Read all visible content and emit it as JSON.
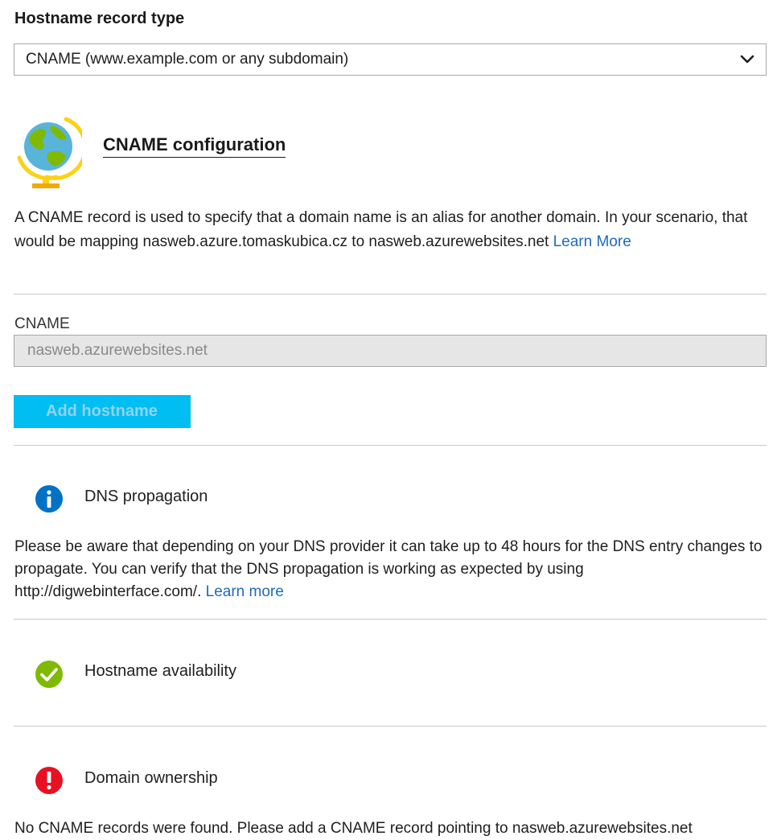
{
  "record_type": {
    "label": "Hostname record type",
    "selected": "CNAME (www.example.com or any subdomain)"
  },
  "cname_config": {
    "title": "CNAME configuration",
    "description": "A CNAME record is used to specify that a domain name is an alias for another domain. In your scenario, that would be mapping nasweb.azure.tomaskubica.cz to nasweb.azurewebsites.net ",
    "learn_more": "Learn More"
  },
  "cname_field": {
    "label": "CNAME",
    "value": "nasweb.azurewebsites.net"
  },
  "add_hostname": {
    "label": "Add hostname"
  },
  "dns_propagation": {
    "title": "DNS propagation",
    "text": "Please be aware that depending on your DNS provider it can take up to 48 hours for the DNS entry changes to propagate. You can verify that the DNS propagation is working as expected by using http://digwebinterface.com/. ",
    "learn_more": "Learn more",
    "icon": "info-icon",
    "color": "#0072c6"
  },
  "hostname_availability": {
    "title": "Hostname availability",
    "icon": "check-icon",
    "color": "#7fba00"
  },
  "domain_ownership": {
    "title": "Domain ownership",
    "text": "No CNAME records were found. Please add a CNAME record pointing to nasweb.azurewebsites.net",
    "icon": "error-icon",
    "color": "#e81123"
  },
  "colors": {
    "accent": "#00bcf2",
    "link": "#1f6bb8"
  }
}
